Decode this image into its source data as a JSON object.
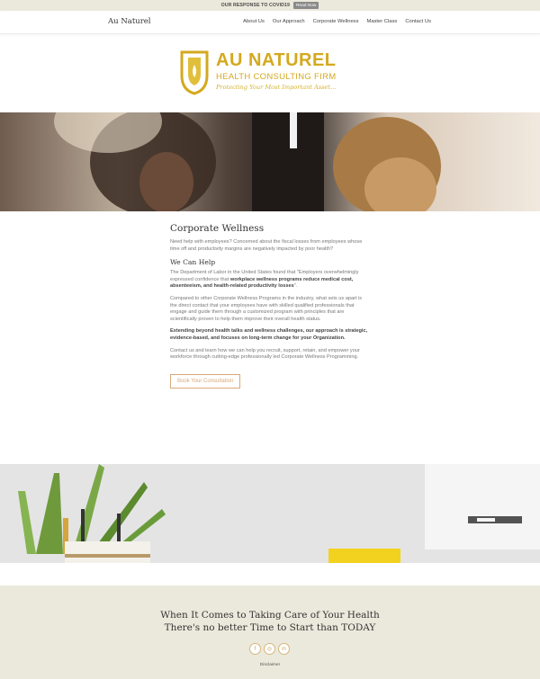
{
  "topbar": {
    "message": "OUR RESPONSE TO COVID19",
    "button": "Read Now"
  },
  "nav": {
    "brand": "Au Naturel",
    "items": [
      "About Us",
      "Our Approach",
      "Corporate Wellness",
      "Master Class",
      "Contact Us"
    ]
  },
  "logo": {
    "name": "AU NATUREL",
    "subtitle": "HEALTH CONSULTING FIRM",
    "tagline": "Protecting Your Most Important Asset...",
    "brand_color": "#d4a91f"
  },
  "content": {
    "title": "Corporate Wellness",
    "intro": "Need help with employees? Concerned about the fiscal losses from employees whose time off and productivity margins are negatively impacted by poor health?",
    "subtitle": "We Can Help",
    "p1_start": "The Department of Labor in the United States found that \"Employers overwhelmingly expressed confidence that ",
    "p1_bold": "workplace wellness programs reduce medical cost, absenteeism, and health-related productivity losses",
    "p1_end": "\".",
    "p2": "Compared to other Corporate Wellness Programs in the industry, what sets us apart is the direct contact that your employees have with skilled qualified professionals that engage and guide them through a customized program with principles that are scientifically proven to help them improve their overall health status.",
    "p3": "Extending beyond health talks and wellness challenges, our approach is strategic, evidence-based, and focuses on long-term change for your Organization.",
    "p4": "Contact us and learn how we can help you recruit, support, retain, and empower your workforce through cutting-edge professionally led Corporate Wellness Programming.",
    "cta": "Book Your Consultation"
  },
  "footer": {
    "line1": "When It Comes to Taking Care of Your Health",
    "line2": "There's no better Time to Start than TODAY",
    "social": [
      {
        "icon": "facebook-icon",
        "glyph": "f"
      },
      {
        "icon": "instagram-icon",
        "glyph": "◎"
      },
      {
        "icon": "linkedin-icon",
        "glyph": "in"
      }
    ],
    "disclaimer": "Disclaimer"
  }
}
